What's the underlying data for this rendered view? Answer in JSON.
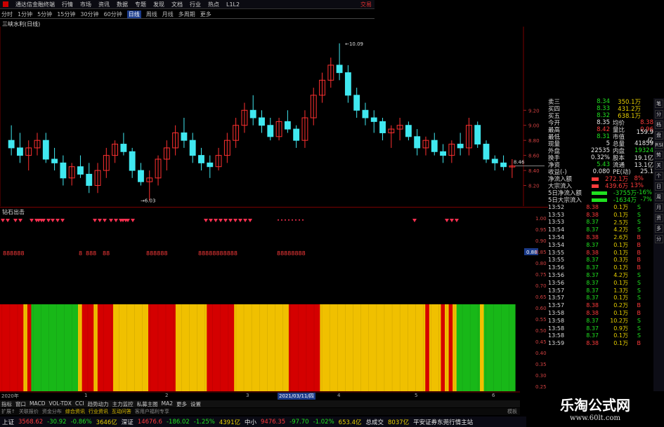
{
  "titlebar": {
    "app": "通达信金融终端",
    "menus": [
      "行情",
      "市场",
      "资讯",
      "数据",
      "专题",
      "发现",
      "文档",
      "行业",
      "热点",
      "L1L2"
    ],
    "right": "交易"
  },
  "timeframes": [
    "分时",
    "1分钟",
    "5分钟",
    "15分钟",
    "30分钟",
    "60分钟",
    "日线",
    "周线",
    "月线",
    "多周期",
    "更多"
  ],
  "active_tf": "日线",
  "stock_title": "三峡水利(日线)",
  "chart_data": {
    "type": "candlestick",
    "title": "三峡水利(日线)",
    "high_label": "10.09",
    "low_label": "6.03",
    "last_label": "8.46",
    "yticks": [
      "9.20",
      "9.00",
      "8.80",
      "8.60",
      "8.40",
      "8.20"
    ],
    "ohlc": [
      [
        8.8,
        9.0,
        8.6,
        8.7
      ],
      [
        8.7,
        8.9,
        8.5,
        8.6
      ],
      [
        8.6,
        8.8,
        8.4,
        8.7
      ],
      [
        8.7,
        8.9,
        8.6,
        8.8
      ],
      [
        8.8,
        8.9,
        8.5,
        8.55
      ],
      [
        8.55,
        8.7,
        8.4,
        8.5
      ],
      [
        8.5,
        8.6,
        8.2,
        8.3
      ],
      [
        8.3,
        8.5,
        8.2,
        8.45
      ],
      [
        8.45,
        8.6,
        8.3,
        8.35
      ],
      [
        8.35,
        8.5,
        8.1,
        8.2
      ],
      [
        8.2,
        8.5,
        8.1,
        8.4
      ],
      [
        8.4,
        8.7,
        8.3,
        8.6
      ],
      [
        8.6,
        8.8,
        8.5,
        8.75
      ],
      [
        8.75,
        8.9,
        8.6,
        8.65
      ],
      [
        8.65,
        8.7,
        8.3,
        8.4
      ],
      [
        8.4,
        8.5,
        8.2,
        8.25
      ],
      [
        8.25,
        8.4,
        8.0,
        8.3
      ],
      [
        8.3,
        8.6,
        8.2,
        8.55
      ],
      [
        8.55,
        8.8,
        8.4,
        8.7
      ],
      [
        8.7,
        9.0,
        8.6,
        8.9
      ],
      [
        8.9,
        9.1,
        8.7,
        8.8
      ],
      [
        8.8,
        8.9,
        8.5,
        8.6
      ],
      [
        8.6,
        8.7,
        8.4,
        8.5
      ],
      [
        8.5,
        8.6,
        8.3,
        8.45
      ],
      [
        8.45,
        8.7,
        8.4,
        8.6
      ],
      [
        8.6,
        8.9,
        8.5,
        8.8
      ],
      [
        8.8,
        9.1,
        8.7,
        9.0
      ],
      [
        9.0,
        9.3,
        8.9,
        9.2
      ],
      [
        9.2,
        9.4,
        9.0,
        9.1
      ],
      [
        9.1,
        9.2,
        8.9,
        9.0
      ],
      [
        9.0,
        9.1,
        8.8,
        8.85
      ],
      [
        8.85,
        9.1,
        8.8,
        9.05
      ],
      [
        9.05,
        9.2,
        8.9,
        8.95
      ],
      [
        8.95,
        9.0,
        8.7,
        8.8
      ],
      [
        8.8,
        9.2,
        8.7,
        9.1
      ],
      [
        9.1,
        9.5,
        9.0,
        9.4
      ],
      [
        9.4,
        9.7,
        9.3,
        9.6
      ],
      [
        9.6,
        9.9,
        9.5,
        9.8
      ],
      [
        9.8,
        10.09,
        9.6,
        9.7
      ],
      [
        9.7,
        9.8,
        9.3,
        9.4
      ],
      [
        9.4,
        9.5,
        9.1,
        9.2
      ],
      [
        9.2,
        9.3,
        9.0,
        9.1
      ],
      [
        9.1,
        9.2,
        8.9,
        9.05
      ],
      [
        9.05,
        9.1,
        8.8,
        8.9
      ],
      [
        8.9,
        9.0,
        8.7,
        8.95
      ],
      [
        8.95,
        9.1,
        8.8,
        9.0
      ],
      [
        9.0,
        9.05,
        8.8,
        8.85
      ],
      [
        8.85,
        8.95,
        8.6,
        8.7
      ],
      [
        8.7,
        8.85,
        8.6,
        8.8
      ],
      [
        8.8,
        8.9,
        8.6,
        8.65
      ],
      [
        8.65,
        8.75,
        8.5,
        8.6
      ],
      [
        8.6,
        8.8,
        8.5,
        8.75
      ],
      [
        8.75,
        8.9,
        8.6,
        8.7
      ],
      [
        8.7,
        9.1,
        8.6,
        9.0
      ],
      [
        9.0,
        9.05,
        8.7,
        8.75
      ],
      [
        8.75,
        8.8,
        8.5,
        8.55
      ],
      [
        8.55,
        8.6,
        8.4,
        8.5
      ],
      [
        8.5,
        8.6,
        8.4,
        8.45
      ],
      [
        8.45,
        8.55,
        8.3,
        8.46
      ]
    ]
  },
  "indicator": {
    "label": "钻石出击",
    "yticks": [
      "1.00",
      "0.95",
      "0.90",
      "0.85",
      "0.80",
      "0.75",
      "0.70",
      "0.65",
      "0.60",
      "0.55",
      "0.50",
      "0.45",
      "0.40",
      "0.35",
      "0.30",
      "0.25"
    ],
    "value_box": "0.88",
    "signal_text": "8888888"
  },
  "stripes": {
    "colors": {
      "red": "#d40000",
      "yellow": "#f0c000",
      "green": "#18b818"
    },
    "sequence": "RRRRRRYRGGGGGGGGGGGGYRRRYRRRRYYYYYYYYYRRRRRRRYYYYYYYYRRRRRRRYYYYYYYYYYYYYYRRRRRRRRYYYYYYYYYYYYYYYYYYYYYYYYYYYRYYYRYRYGGGGGGYGGGGGGGG"
  },
  "datebar": {
    "labels": [
      "2020年",
      "1",
      "2",
      "3",
      "2021/03/11/四",
      "4",
      "5",
      "6"
    ]
  },
  "tabs": [
    "指标",
    "窗口",
    "MACD",
    "VOL-TDX",
    "CCI",
    "趋势动力",
    "主力监控",
    "私募主图",
    "MA2",
    "更多",
    "设置"
  ],
  "tabs2": [
    "扩展↑",
    "关联报价",
    "资金分布",
    "综合资讯",
    "行业资讯",
    "互动问答",
    "客用户福利专享"
  ],
  "tabs2_right": "模板",
  "index_bar": [
    {
      "name": "上证",
      "value": "3568.62",
      "chg": "-30.92",
      "pct": "-0.86%",
      "amt": "3646亿"
    },
    {
      "name": "深证",
      "value": "14676.6",
      "chg": "-186.02",
      "pct": "-1.25%",
      "amt": "4391亿"
    },
    {
      "name": "中小",
      "value": "9476.35",
      "chg": "-97.70",
      "pct": "-1.02%",
      "amt": "653.4亿"
    },
    {
      "name": "总成交",
      "value": "8037亿",
      "chg": "",
      "pct": "",
      "amt": ""
    }
  ],
  "broker": "平安证券东莞行情主站",
  "quote": {
    "asks": [
      {
        "l": "卖三",
        "p": "8.34",
        "q": "350.1万"
      },
      {
        "l": "买四",
        "p": "8.33",
        "q": "431.2万"
      },
      {
        "l": "买五",
        "p": "8.32",
        "q": "638.1万"
      }
    ],
    "stats": [
      {
        "l1": "今开",
        "v1": "8.35",
        "l2": "均价",
        "v2": "8.38"
      },
      {
        "l1": "最高",
        "v1": "8.42",
        "l2": "量比",
        "v2": "0.96"
      },
      {
        "l1": "最低",
        "v1": "8.31",
        "l2": "市值",
        "v2": "159.9亿"
      },
      {
        "l1": "现量",
        "v1": "5",
        "l2": "总量",
        "v2": "41859"
      },
      {
        "l1": "外盘",
        "v1": "22535",
        "l2": "内盘",
        "v2": "19324"
      },
      {
        "l1": "换手",
        "v1": "0.32%",
        "l2": "股本",
        "v2": "19.1亿"
      },
      {
        "l1": "净资",
        "v1": "5.43",
        "l2": "流通",
        "v2": "13.1亿"
      },
      {
        "l1": "收益(-)",
        "v1": "0.080",
        "l2": "PE(动)",
        "v2": "25.1"
      }
    ],
    "flows": [
      {
        "l": "净流入额",
        "v": "272.1万",
        "pct": "8%"
      },
      {
        "l": "大宗流入",
        "v": "439.6万",
        "pct": "13%"
      },
      {
        "l": "5日净流入额",
        "v": "-3755万",
        "pct": "-16%"
      },
      {
        "l": "5日大宗流入",
        "v": "-1634万",
        "pct": "-7%"
      }
    ],
    "ticks": [
      [
        "13:52",
        "8.38",
        "0.1万",
        "S"
      ],
      [
        "13:53",
        "8.38",
        "0.1万",
        "S"
      ],
      [
        "13:53",
        "8.37",
        "2.5万",
        "S"
      ],
      [
        "13:54",
        "8.37",
        "4.2万",
        "S"
      ],
      [
        "13:54",
        "8.38",
        "2.6万",
        "B"
      ],
      [
        "13:54",
        "8.37",
        "0.1万",
        "B"
      ],
      [
        "13:55",
        "8.38",
        "0.1万",
        "B"
      ],
      [
        "13:55",
        "8.37",
        "0.3万",
        "B"
      ],
      [
        "13:56",
        "8.37",
        "0.1万",
        "B"
      ],
      [
        "13:56",
        "8.37",
        "4.2万",
        "S"
      ],
      [
        "13:56",
        "8.37",
        "0.1万",
        "S"
      ],
      [
        "13:57",
        "8.37",
        "1.3万",
        "S"
      ],
      [
        "13:57",
        "8.37",
        "0.1万",
        "S"
      ],
      [
        "13:57",
        "8.38",
        "0.2万",
        "B"
      ],
      [
        "13:58",
        "8.38",
        "0.1万",
        "B"
      ],
      [
        "13:58",
        "8.37",
        "10.2万",
        "S"
      ],
      [
        "13:58",
        "8.37",
        "0.9万",
        "S"
      ],
      [
        "13:58",
        "8.37",
        "0.1万",
        "S"
      ],
      [
        "13:59",
        "8.38",
        "0.1万",
        "B"
      ]
    ]
  },
  "sidebar": [
    "笔",
    "分",
    "档",
    "盘",
    "RSI",
    "势",
    "关",
    "个",
    "日",
    "周",
    "月",
    "资",
    "多",
    "分"
  ],
  "watermark": {
    "title": "乐淘公式网",
    "url": "www.60lt.com"
  }
}
